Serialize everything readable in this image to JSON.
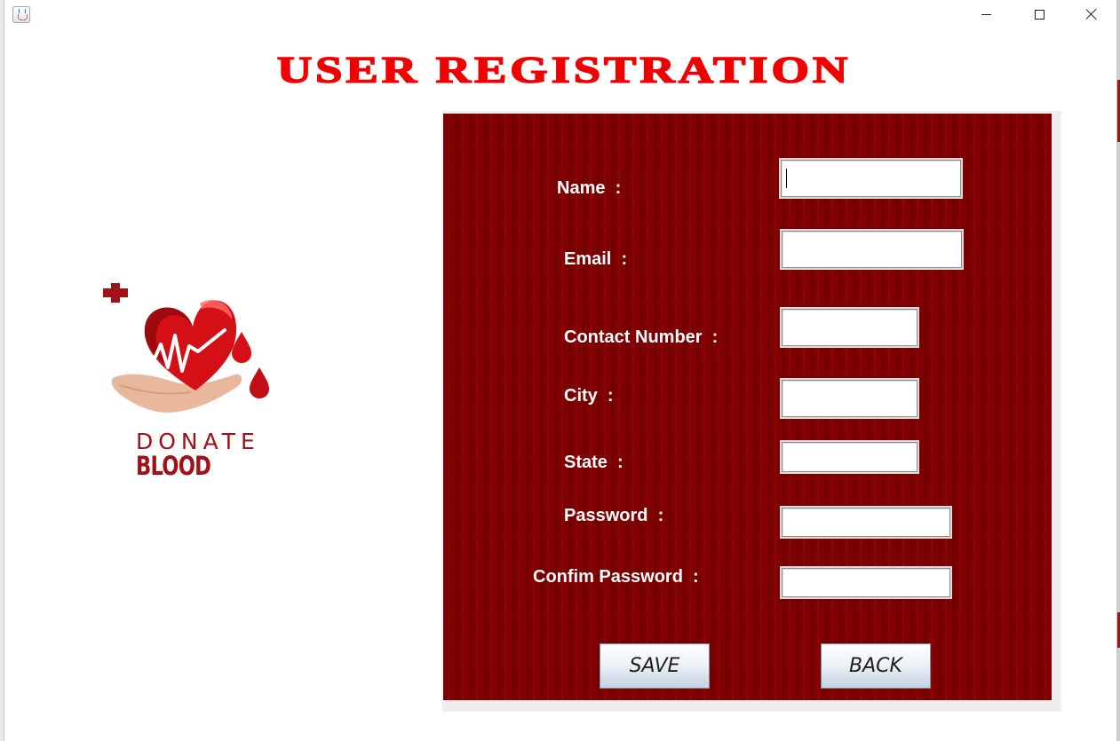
{
  "window": {
    "minimize_label": "",
    "maximize_label": "",
    "close_label": ""
  },
  "heading": "USER REGISTRATION",
  "logo": {
    "line1": "DONATE",
    "line2": "BLOOD"
  },
  "form": {
    "fields": [
      {
        "label": "Name  :",
        "value": ""
      },
      {
        "label": "Email  :",
        "value": ""
      },
      {
        "label": "Contact Number  :",
        "value": ""
      },
      {
        "label": "City  :",
        "value": ""
      },
      {
        "label": "State  :",
        "value": ""
      },
      {
        "label": "Password  :",
        "value": ""
      },
      {
        "label": "Confim Password  :",
        "value": ""
      }
    ],
    "save_label": "SAVE",
    "back_label": "BACK"
  },
  "colors": {
    "heading": "#f00000",
    "panel": "#7d0000",
    "logo_red": "#a31118"
  },
  "icons": [
    "java-app-icon",
    "minimize-icon",
    "maximize-icon",
    "close-icon",
    "heart-hand-logo-icon",
    "plus-icon"
  ]
}
